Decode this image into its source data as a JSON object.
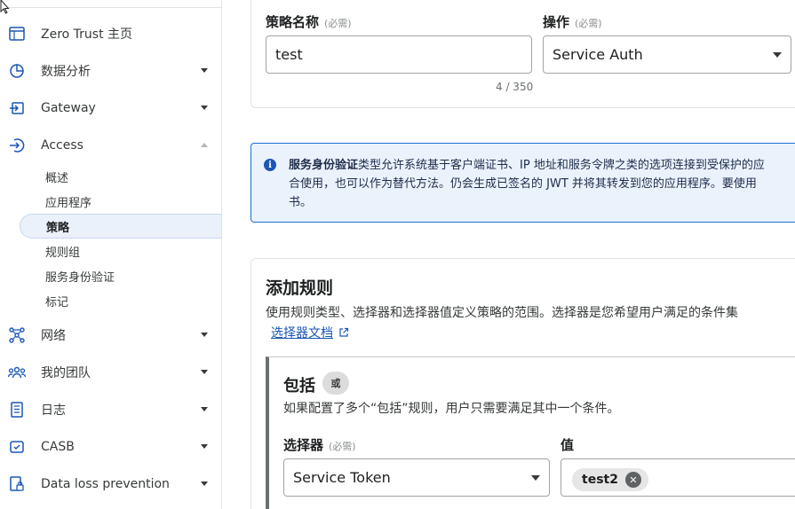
{
  "sidebar": {
    "items": [
      {
        "label": "Zero Trust 主页",
        "icon": "browser-window-icon"
      },
      {
        "label": "数据分析",
        "icon": "pie-chart-icon"
      },
      {
        "label": "Gateway",
        "icon": "gateway-icon"
      },
      {
        "label": "Access",
        "icon": "access-icon"
      },
      {
        "label": "网络",
        "icon": "network-icon"
      },
      {
        "label": "我的团队",
        "icon": "team-icon"
      },
      {
        "label": "日志",
        "icon": "logs-icon"
      },
      {
        "label": "CASB",
        "icon": "casb-icon"
      },
      {
        "label": "Data loss prevention",
        "icon": "dlp-icon"
      }
    ],
    "access_sub": [
      "概述",
      "应用程序",
      "策略",
      "规则组",
      "服务身份验证",
      "标记"
    ],
    "active_sub": "策略"
  },
  "policy": {
    "name_label": "策略名称",
    "name_required": "(必需)",
    "name_value": "test",
    "char_count": "4 / 350",
    "action_label": "操作",
    "action_required": "(必需)",
    "action_value": "Service Auth"
  },
  "info": {
    "bold": "服务身份验证",
    "line1": "类型允许系统基于客户端证书、IP 地址和服务令牌之类的选项连接到受保护的应",
    "line2": "合使用，也可以作为替代方法。仍会生成已签名的 JWT 并将其转发到您的应用程序。要使用",
    "line3": "书。"
  },
  "rules": {
    "title": "添加规则",
    "description": "使用规则类型、选择器和选择器值定义策略的范围。选择器是您希望用户满足的条件集",
    "doc_link": "选择器文档",
    "include": {
      "title": "包括",
      "or_badge": "或",
      "description": "如果配置了多个“包括”规则，用户只需要满足其中一个条件。",
      "selector_label": "选择器",
      "selector_required": "(必需)",
      "selector_value": "Service Token",
      "value_label": "值",
      "value_tag": "test2"
    }
  },
  "colors": {
    "accent": "#1a56b5",
    "info_bg": "#eaf2fc",
    "active_bg": "#eaf1fb"
  }
}
